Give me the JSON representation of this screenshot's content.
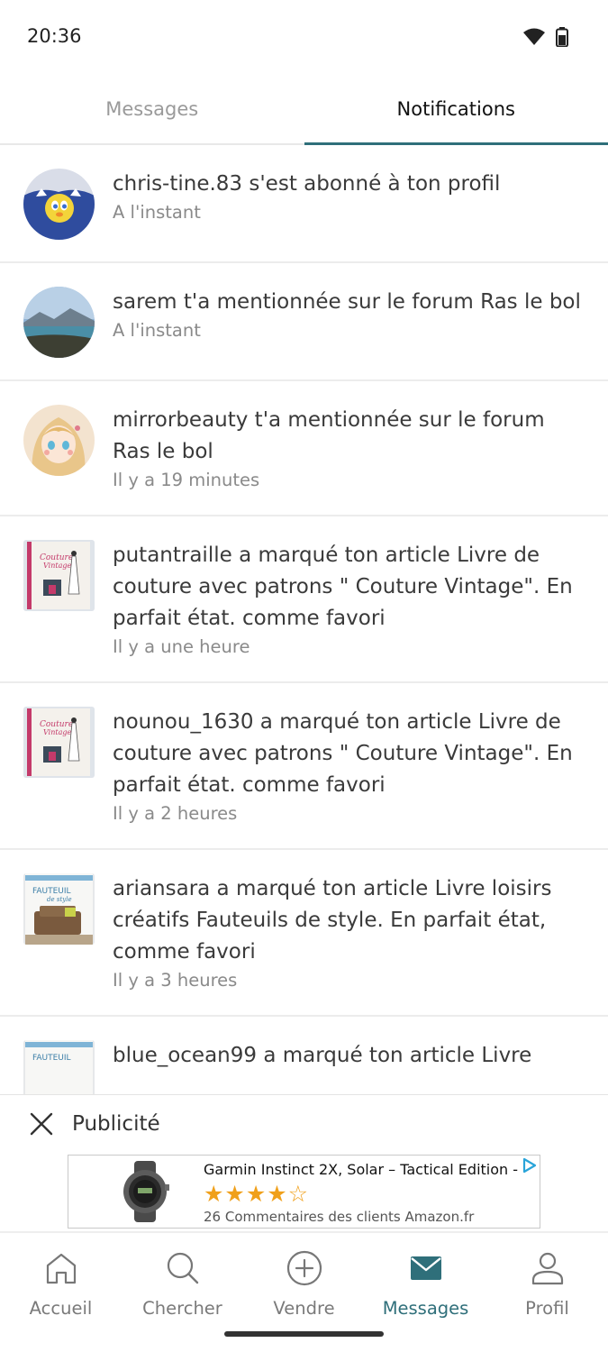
{
  "status_bar": {
    "time": "20:36"
  },
  "tabs": [
    {
      "label": "Messages",
      "active": false
    },
    {
      "label": "Notifications",
      "active": true
    }
  ],
  "notifications": [
    {
      "message": "chris-tine.83 s'est abonné à ton profil",
      "time": "A l'instant",
      "thumb": "tweety-avatar"
    },
    {
      "message": "sarem t'a mentionnée sur le forum Ras le bol",
      "time": "A l'instant",
      "thumb": "landscape-avatar"
    },
    {
      "message": "mirrorbeauty t'a mentionnée sur le forum Ras le bol",
      "time": "Il y a 19 minutes",
      "thumb": "anime-girl-avatar"
    },
    {
      "message": "putantraille a marqué ton article Livre de couture avec patrons \" Couture Vintage\". En parfait état. comme favori",
      "time": "Il y a une heure",
      "thumb": "couture-vintage-book"
    },
    {
      "message": "nounou_1630 a marqué ton article Livre de couture avec patrons \" Couture Vintage\". En parfait état. comme favori",
      "time": "Il y a 2 heures",
      "thumb": "couture-vintage-book"
    },
    {
      "message": "ariansara a marqué ton article Livre loisirs créatifs Fauteuils de style. En parfait état, comme favori",
      "time": "Il y a 3 heures",
      "thumb": "fauteuil-book"
    },
    {
      "message": "blue_ocean99 a marqué ton article Livre",
      "time": "",
      "thumb": "fauteuil-book"
    }
  ],
  "ad": {
    "label": "Publicité",
    "title": "Garmin Instinct 2X, Solar – Tactical Edition -",
    "rating": 4,
    "rating_max": 5,
    "stars_full": "★★★★",
    "stars_empty": "☆",
    "reviews": "26 Commentaires des clients Amazon.fr"
  },
  "bottom_nav": [
    {
      "label": "Accueil",
      "icon": "home-icon",
      "active": false
    },
    {
      "label": "Chercher",
      "icon": "search-icon",
      "active": false
    },
    {
      "label": "Vendre",
      "icon": "plus-circle-icon",
      "active": false
    },
    {
      "label": "Messages",
      "icon": "mail-icon",
      "active": true
    },
    {
      "label": "Profil",
      "icon": "person-icon",
      "active": false
    }
  ],
  "colors": {
    "accent": "#2f6f7a",
    "star": "#f0a01b"
  }
}
